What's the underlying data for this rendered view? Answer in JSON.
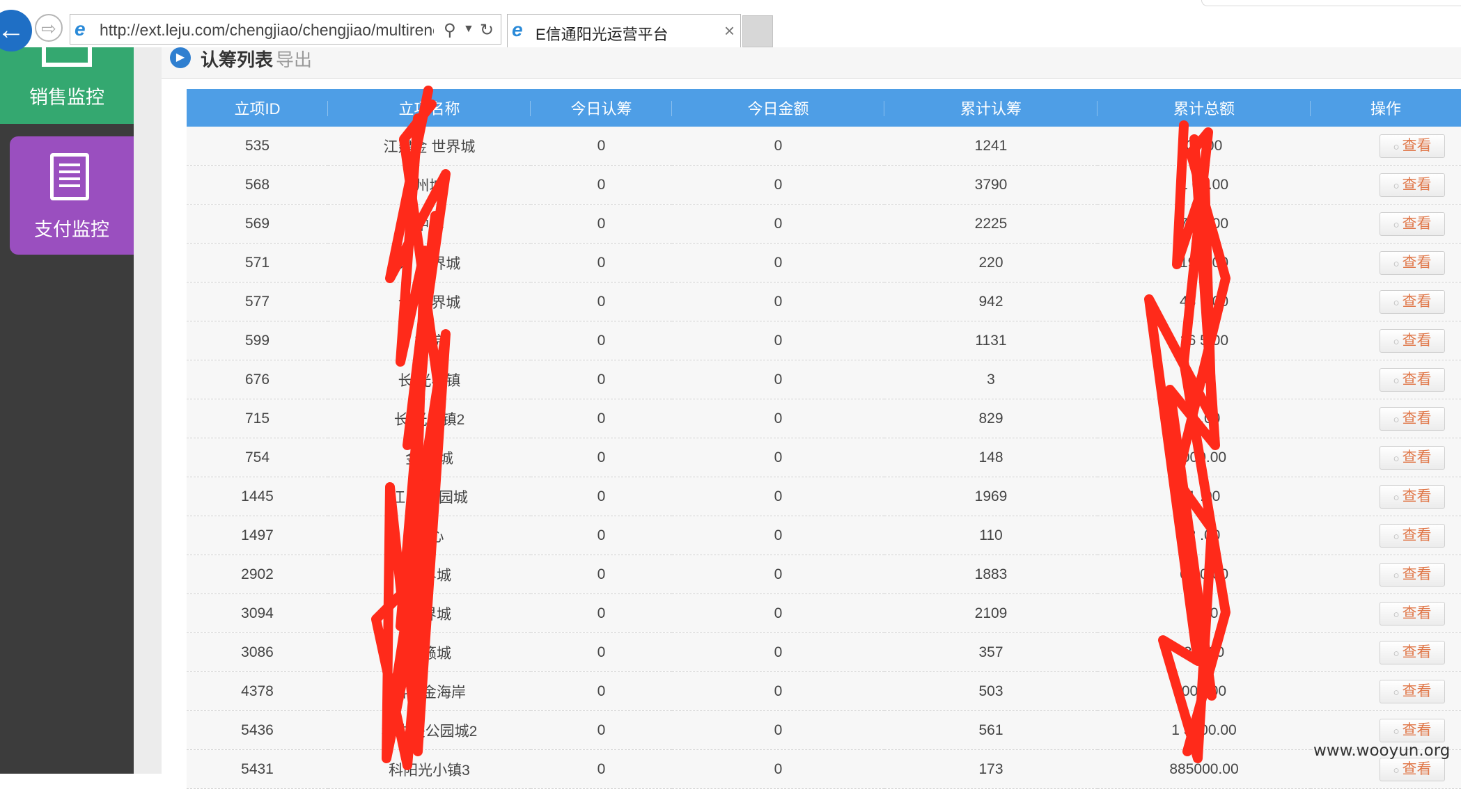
{
  "browser": {
    "url": "http://ext.leju.com/chengjiao/chengjiao/multirenc",
    "tab_title": "E信通阳光运营平台",
    "tab_close": "×"
  },
  "sidebar": {
    "items": [
      {
        "label": "销售监控",
        "icon": "monitor-icon",
        "color": "#34a870"
      },
      {
        "label": "支付监控",
        "icon": "document-icon",
        "color": "#9a4fbf"
      }
    ]
  },
  "panel": {
    "title": "认筹列表",
    "export_label": "导出"
  },
  "table": {
    "columns": [
      "立项ID",
      "立项名称",
      "今日认筹",
      "今日金额",
      "累计认筹",
      "累计总额",
      "操作"
    ],
    "action_label": "查看",
    "rows": [
      {
        "id": "535",
        "name": "江建金  世界城",
        "today_count": "0",
        "today_amount": "0",
        "total_count": "1241",
        "total_amount": "     00.00"
      },
      {
        "id": "568",
        "name": "       州城",
        "today_count": "0",
        "today_amount": "0",
        "total_count": "3790",
        "total_amount": "1      00.00"
      },
      {
        "id": "569",
        "name": "  中心",
        "today_count": "0",
        "today_amount": "0",
        "total_count": "2225",
        "total_amount": "74     0.00"
      },
      {
        "id": "571",
        "name": "茶     世界城",
        "today_count": "0",
        "today_amount": "0",
        "total_count": "220",
        "total_amount": "19     0.00"
      },
      {
        "id": "577",
        "name": "合     世界城",
        "today_count": "0",
        "today_amount": "0",
        "total_count": "942",
        "total_amount": "43     0.00"
      },
      {
        "id": "599",
        "name": "      御院",
        "today_count": "0",
        "today_amount": "0",
        "total_count": "1131",
        "total_amount": "16     5.00"
      },
      {
        "id": "676",
        "name": "长     光小镇",
        "today_count": "0",
        "today_amount": "0",
        "total_count": "3",
        "total_amount": "     00"
      },
      {
        "id": "715",
        "name": "长     光小镇2",
        "today_count": "0",
        "today_amount": "0",
        "total_count": "829",
        "total_amount": "2      .00"
      },
      {
        "id": "754",
        "name": "金     生城",
        "today_count": "0",
        "today_amount": "0",
        "total_count": "148",
        "total_amount": "     000.00"
      },
      {
        "id": "1445",
        "name": "江     央公园城",
        "today_count": "0",
        "today_amount": "0",
        "total_count": "1969",
        "total_amount": "1      .00"
      },
      {
        "id": "1497",
        "name": "     中心",
        "today_count": "0",
        "today_amount": "0",
        "total_count": "110",
        "total_amount": "2      .00"
      },
      {
        "id": "2902",
        "name": "     世界城",
        "today_count": "0",
        "today_amount": "0",
        "total_count": "1883",
        "total_amount": "    61  0.00"
      },
      {
        "id": "3094",
        "name": "     世界城",
        "today_count": "0",
        "today_amount": "0",
        "total_count": "2109",
        "total_amount": "     0.00"
      },
      {
        "id": "3086",
        "name": "     天籁城",
        "today_count": "0",
        "today_amount": "0",
        "total_count": "357",
        "total_amount": "3     0.00"
      },
      {
        "id": "4378",
        "name": "     科黄金海岸",
        "today_count": "0",
        "today_amount": "0",
        "total_count": "503",
        "total_amount": "     000.00"
      },
      {
        "id": "5436",
        "name": "     科中央公园城2",
        "today_count": "0",
        "today_amount": "0",
        "total_count": "561",
        "total_amount": "1    5000.00"
      },
      {
        "id": "5431",
        "name": "     科阳光小镇3",
        "today_count": "0",
        "today_amount": "0",
        "total_count": "173",
        "total_amount": "885000.00"
      }
    ]
  },
  "watermark": "www.wooyun.org",
  "colors": {
    "header_blue": "#4e9ee6",
    "sidebar_dark": "#3c3c3c",
    "redaction_red": "#ff2a1a",
    "action_text": "#e0784a"
  }
}
